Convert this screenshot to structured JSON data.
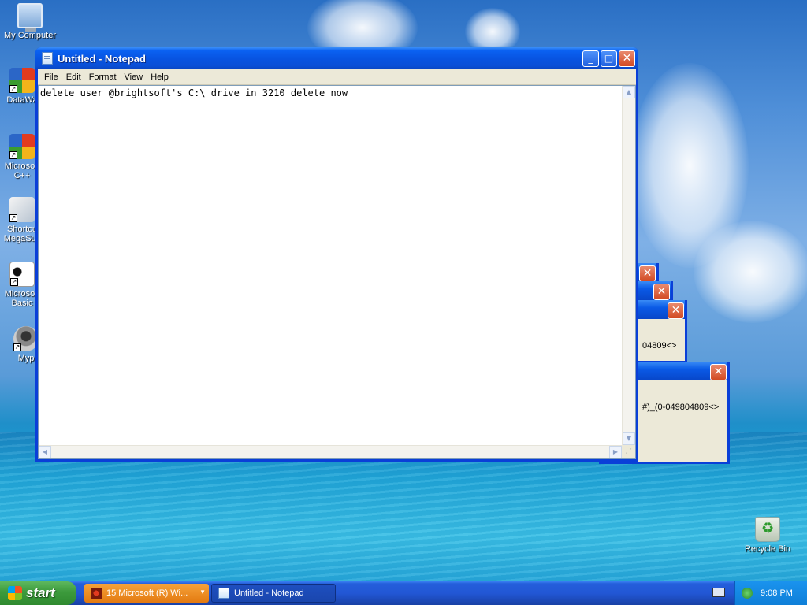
{
  "desktop": {
    "icons": [
      {
        "label": "My Computer"
      },
      {
        "label": "DataWa"
      },
      {
        "label": "Microsoft C++"
      },
      {
        "label": "Shortcu MegaSus"
      },
      {
        "label": "Microsoft Basic"
      },
      {
        "label": "Myp"
      },
      {
        "label": "Recycle Bin"
      }
    ]
  },
  "background_dialogs": [
    {
      "text": ""
    },
    {
      "text": ""
    },
    {
      "text": "04809<>"
    },
    {
      "text": "#)_(0-049804809<>"
    }
  ],
  "notepad": {
    "title": "Untitled - Notepad",
    "menu": [
      "File",
      "Edit",
      "Format",
      "View",
      "Help"
    ],
    "content": "delete user @brightsoft's C:\\ drive in 3210 delete now"
  },
  "taskbar": {
    "start_label": "start",
    "tasks": [
      {
        "label": "15 Microsoft (R) Wi..."
      },
      {
        "label": "Untitled - Notepad"
      }
    ],
    "clock": "9:08 PM"
  }
}
